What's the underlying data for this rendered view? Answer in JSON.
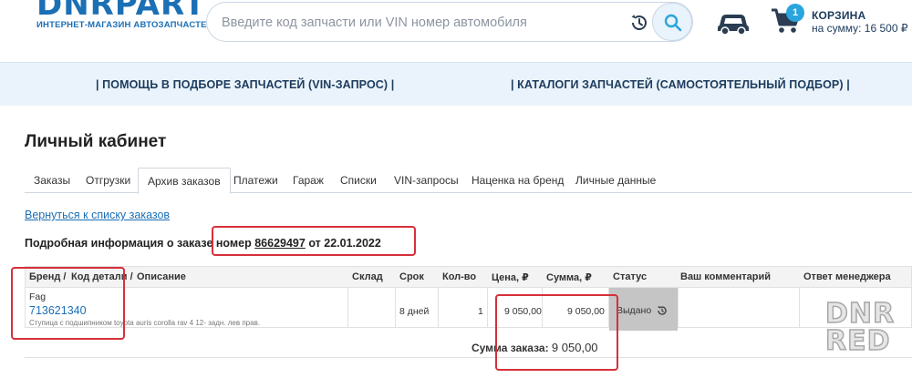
{
  "header": {
    "logo_text": "DNRPART",
    "logo_subtitle": "ИНТЕРНЕТ-МАГАЗИН АВТОЗАПЧАСТЕЙ",
    "search_placeholder": "Введите код запчасти или VIN номер автомобиля",
    "cart_count": "1",
    "cart_title": "КОРЗИНА",
    "cart_sum": "на сумму: 16 500 ₽"
  },
  "nav": {
    "vin_help": "| ПОМОЩЬ В ПОДБОРЕ ЗАПЧАСТЕЙ (VIN-ЗАПРОС) |",
    "catalogs": "| КАТАЛОГИ ЗАПЧАСТЕЙ (САМОСТОЯТЕЛЬНЫЙ ПОДБОР) |"
  },
  "page_title": "Личный кабинет",
  "tabs": [
    "Заказы",
    "Отгрузки",
    "Архив заказов",
    "Платежи",
    "Гараж",
    "Списки",
    "VIN-запросы",
    "Наценка на бренд",
    "Личные данные"
  ],
  "active_tab": "Архив заказов",
  "back_link": "Вернуться к списку заказов",
  "order": {
    "info_prefix": "Подробная информация о заказе номер",
    "number": "86629497",
    "date_text": "от 22.01.2022"
  },
  "table": {
    "headers": {
      "brand": "Бренд /",
      "code": "Код детали /",
      "desc": "Описание",
      "warehouse": "Склад",
      "term": "Срок",
      "qty": "Кол-во",
      "price": "Цена, ₽",
      "sum": "Сумма, ₽",
      "status": "Статус",
      "comment": "Ваш комментарий",
      "manager": "Ответ менеджера"
    },
    "row": {
      "brand": "Fag",
      "code": "713621340",
      "description": "Ступица с подшипником toyota auris corolla rav 4 12- задн. лев прав.",
      "warehouse": "",
      "term": "8 дней",
      "qty": "1",
      "price": "9 050,00",
      "sum": "9 050,00",
      "status": "Выдано"
    },
    "total_label": "Сумма заказа:",
    "total_value": "9 050,00"
  },
  "watermark": [
    "DNR",
    "RED"
  ],
  "colors": {
    "brand_blue": "#1b6fb5",
    "highlight_red": "#d6303a",
    "nav_bg": "#eaf3fb"
  }
}
